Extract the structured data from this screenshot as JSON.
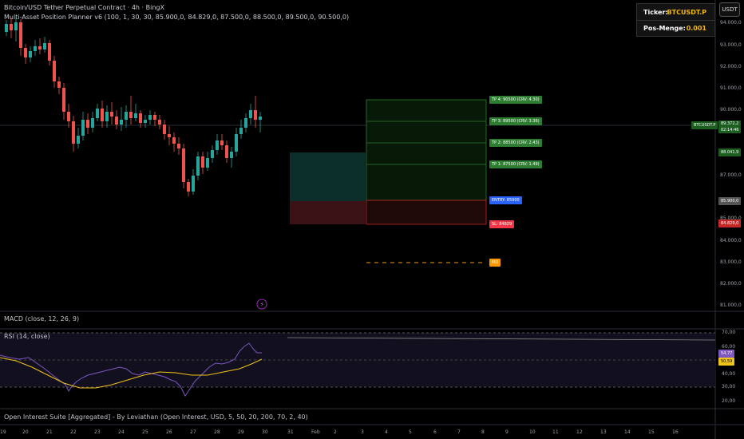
{
  "header": {
    "title": "Bitcoin/USD Tether Perpetual Contract · 4h · BingX",
    "indicator": "Multi-Asset Position Planner v6 (100, 1, 30, 30, 85.900,0, 84.829,0, 87.500,0, 88.500,0, 89.500,0, 90.500,0)",
    "currency_button": "USDT"
  },
  "info_table": {
    "ticker_label": "Ticker:",
    "ticker_value": "BTCUSDT.P",
    "qty_label": "Pos-Menge:",
    "qty_value": "0.001"
  },
  "price_axis": [
    "94.000,0",
    "93.000,0",
    "92.000,0",
    "91.000,0",
    "90.000,0",
    "87.000,0",
    "85.000,0",
    "84.000,0",
    "83.000,0",
    "82.000,0",
    "81.000,0"
  ],
  "price_tags": {
    "symbol": "BTCUSDT.P",
    "last_price": "89.372,2",
    "countdown": "02:14:46",
    "green_level": "88.041,9",
    "entry_level": "85.900,0",
    "sl_level": "84.829,0"
  },
  "plan_labels": {
    "tp4": "TP 4: 90500 (CRV: 4.30)",
    "tp3": "TP 3: 89500 (CRV: 3.36)",
    "tp2": "TP 2: 88500 (CRV: 2.43)",
    "tp1": "TP 1: 87500 (CRV: 1.49)",
    "entry": "ENTRY: 85900",
    "sl": "SL: 84829",
    "mq": "MQ"
  },
  "macd": {
    "label": "MACD (close, 12, 26, 9)"
  },
  "rsi": {
    "label": "RSI (14, close)",
    "axis": [
      "70,00",
      "60,00",
      "40,00",
      "30,00",
      "20,00"
    ],
    "value": "54,77",
    "ma_value": "50,59"
  },
  "oi": {
    "label": "Open Interest Suite [Aggregated] - By Leviathan (Open Interest, USD, 5, 50, 20, 200, 70, 2, 40)"
  },
  "time_axis": [
    "19",
    "20",
    "21",
    "22",
    "23",
    "24",
    "25",
    "26",
    "27",
    "28",
    "29",
    "30",
    "31",
    "Feb",
    "2",
    "3",
    "4",
    "5",
    "6",
    "7",
    "8",
    "9",
    "10",
    "11",
    "12",
    "13",
    "14",
    "15",
    "16"
  ],
  "colors": {
    "up": "#26a69a",
    "down": "#ef5350",
    "tp": "#2e7d32",
    "entry": "#2962ff",
    "sl": "#f23645",
    "mq": "#ff9800",
    "rsi": "#7e57c2",
    "rsi_ma": "#f0c419"
  }
}
